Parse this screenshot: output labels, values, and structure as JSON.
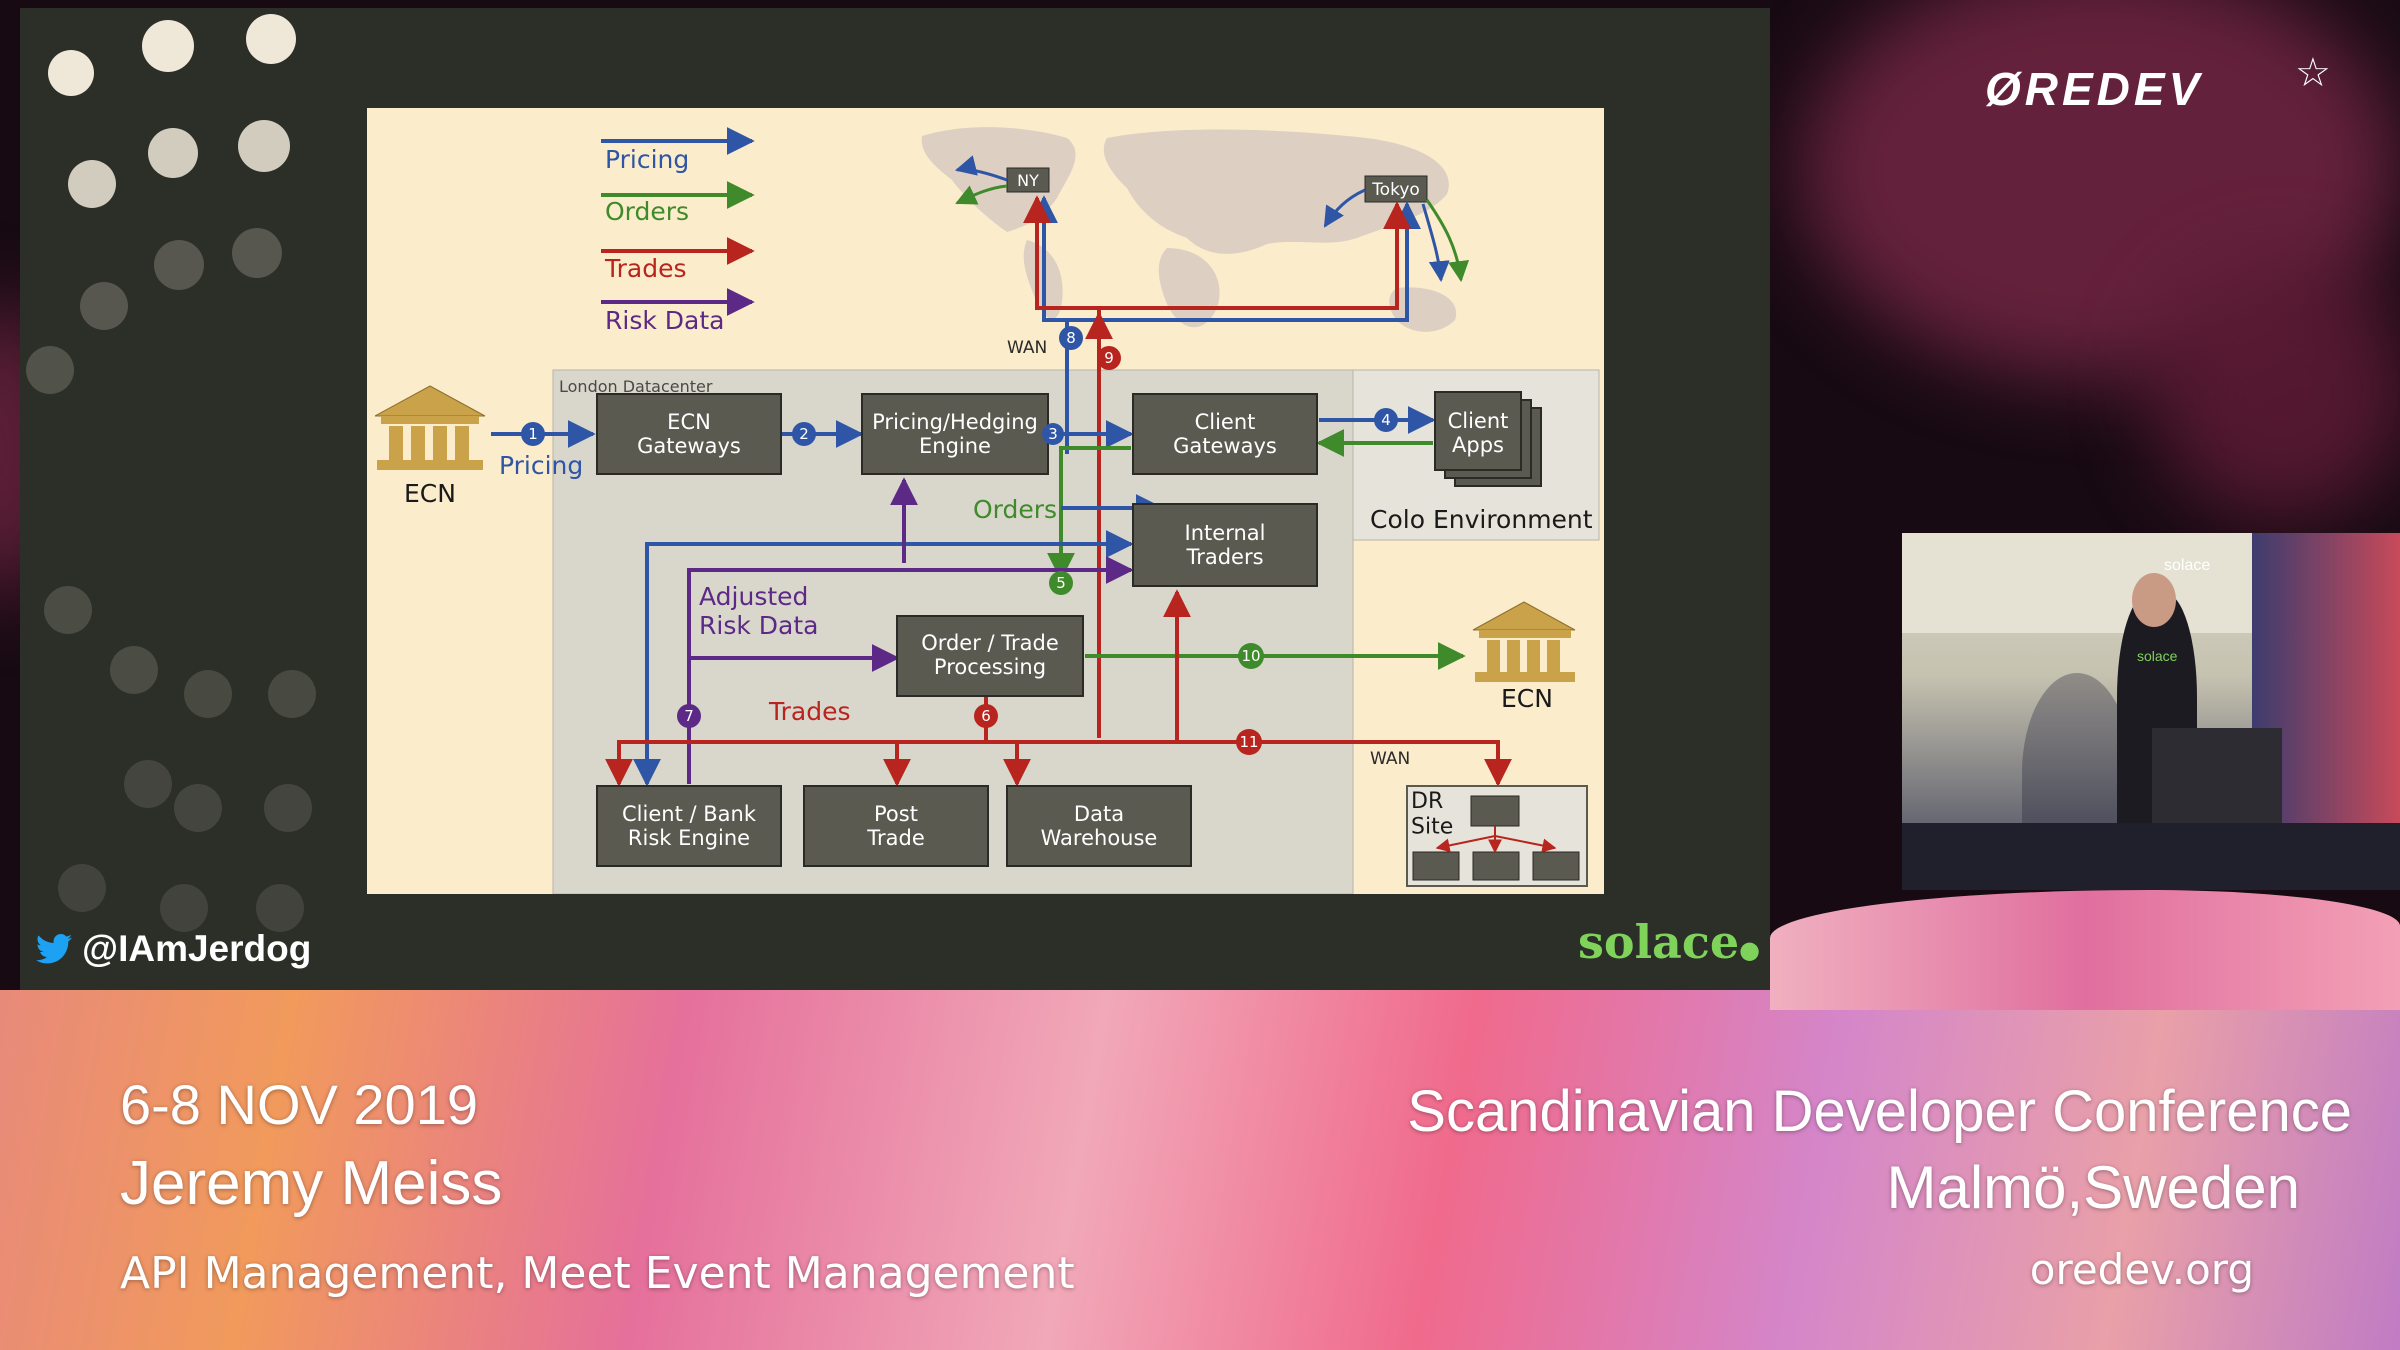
{
  "slide": {
    "legend": [
      {
        "label": "Pricing",
        "color": "#2f56a6"
      },
      {
        "label": "Orders",
        "color": "#3f8a2b"
      },
      {
        "label": "Trades",
        "color": "#b8241e"
      },
      {
        "label": "Risk Data",
        "color": "#5c2a86"
      }
    ],
    "region_labels": {
      "ny": "NY",
      "tokyo": "Tokyo",
      "wan_top": "WAN",
      "wan_bottom": "WAN",
      "london": "London Datacenter",
      "colo": "Colo Environment"
    },
    "boxes": {
      "ecn_gateways": "ECN\nGateways",
      "pricing_hedging": "Pricing/Hedging\nEngine",
      "client_gateways": "Client\nGateways",
      "client_apps": "Client\nApps",
      "internal_traders": "Internal\nTraders",
      "order_trade": "Order / Trade\nProcessing",
      "client_bank_risk": "Client / Bank\nRisk Engine",
      "post_trade": "Post\nTrade",
      "data_warehouse": "Data\nWarehouse",
      "dr_site": "DR\nSite"
    },
    "ecn_label_left": "ECN",
    "ecn_label_right": "ECN",
    "flow_labels": {
      "pricing": "Pricing",
      "orders": "Orders",
      "adjusted": "Adjusted\nRisk Data",
      "trades": "Trades"
    },
    "markers": [
      "1",
      "2",
      "3",
      "4",
      "5",
      "6",
      "7",
      "8",
      "9",
      "10",
      "11"
    ],
    "colors": {
      "pricing": "#2f56a6",
      "orders": "#3f8a2b",
      "trades": "#b8241e",
      "risk": "#5c2a86",
      "box": "#5b5a50",
      "box_text": "#ffffff",
      "panel": "#d9d6cc",
      "map": "#ddd0c2"
    }
  },
  "twitter_handle": "@IAmJerdog",
  "sponsor_logo": "solace",
  "event_logo": "ØREDEV",
  "footer": {
    "date": "6-8 NOV 2019",
    "speaker": "Jeremy Meiss",
    "talk_title": "API Management, Meet Event Management",
    "conference": "Scandinavian Developer Conference",
    "location": "Malmö,Sweden",
    "website": "oredev.org"
  },
  "pip_labels": {
    "shirt": "solace",
    "banner": "solace"
  }
}
